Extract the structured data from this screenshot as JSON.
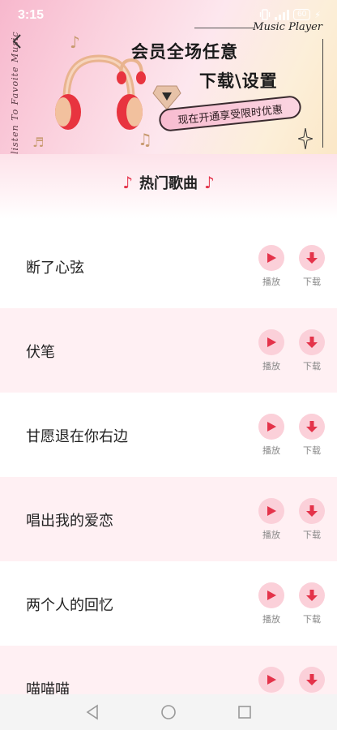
{
  "status_bar": {
    "time": "3:15",
    "battery": "60"
  },
  "banner": {
    "brand": "Music Player",
    "side_text": "listen To Favoite Music",
    "headline_line1": "会员全场任意",
    "headline_line2": "下载\\设置",
    "promo": "现在开通享受限时优惠"
  },
  "section": {
    "title": "热门歌曲"
  },
  "actions": {
    "play_label": "播放",
    "download_label": "下载"
  },
  "songs": [
    {
      "title": "断了心弦"
    },
    {
      "title": "伏笔"
    },
    {
      "title": "甘愿退在你右边"
    },
    {
      "title": "唱出我的爱恋"
    },
    {
      "title": "两个人的回忆"
    },
    {
      "title": "喵喵喵"
    }
  ],
  "colors": {
    "accent": "#e4334a",
    "button_bg": "#fbd0d9",
    "row_alt": "#fff0f3"
  },
  "icons": {
    "back": "back-arrow-icon",
    "play": "play-triangle-icon",
    "download": "download-arrow-icon",
    "nav_back": "triangle-back-icon",
    "nav_home": "circle-home-icon",
    "nav_recent": "square-recent-icon"
  }
}
